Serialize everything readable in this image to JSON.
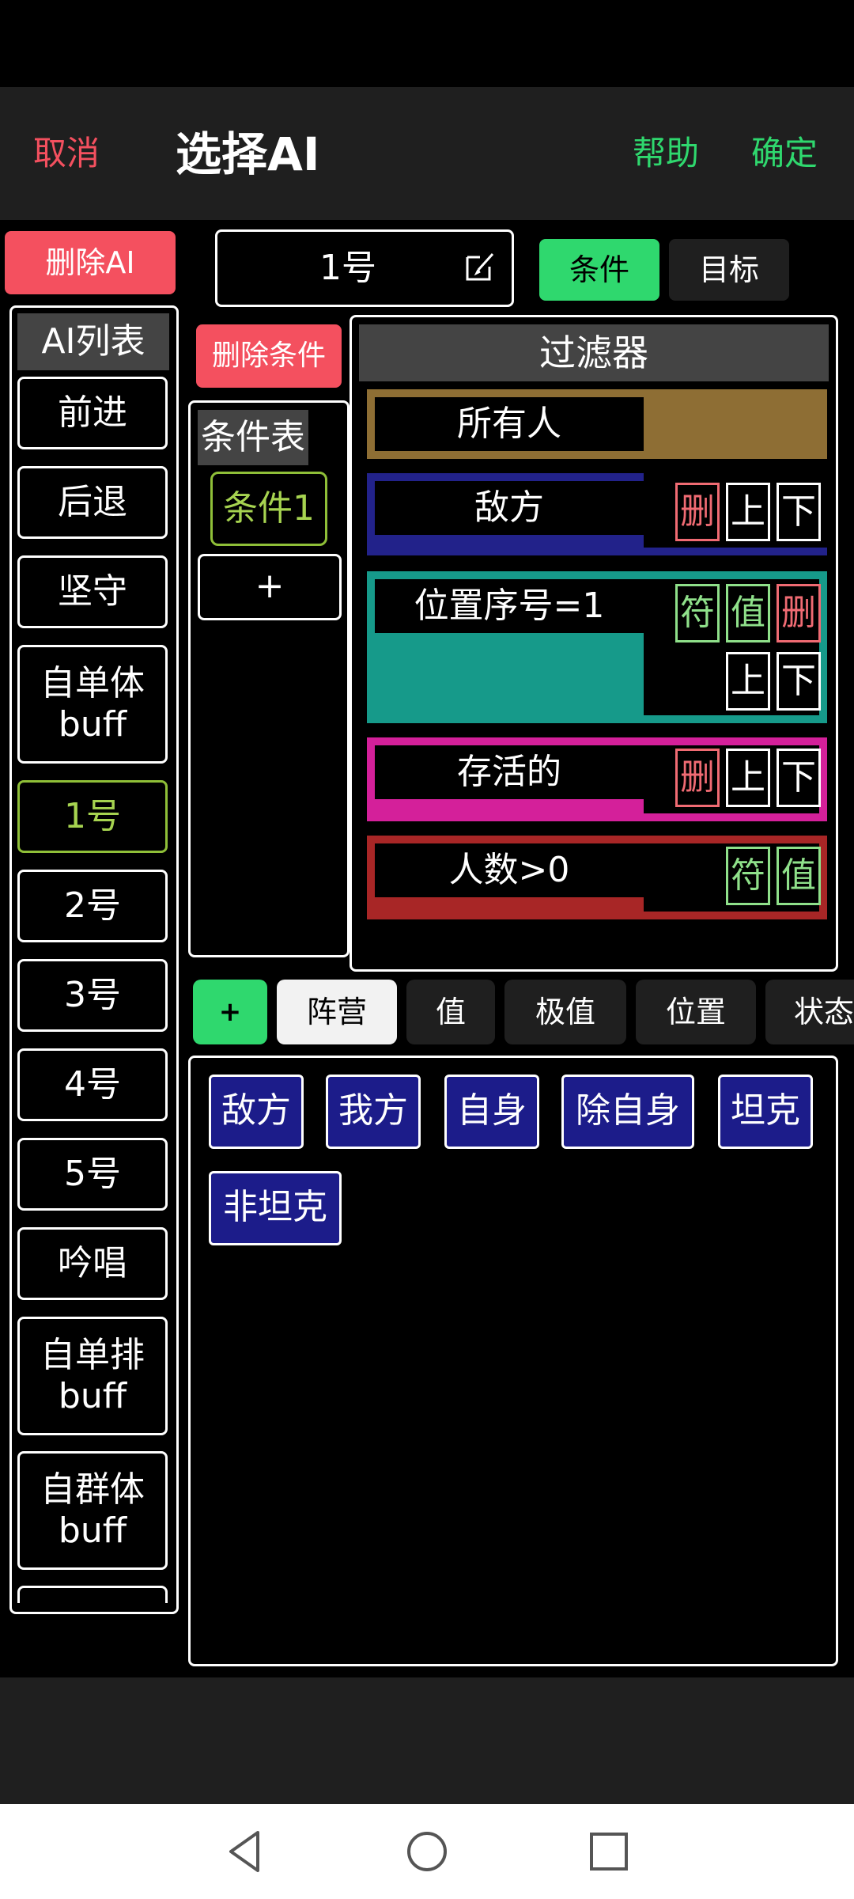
{
  "header": {
    "cancel": "取消",
    "title": "选择AI",
    "help": "帮助",
    "confirm": "确定"
  },
  "ai_panel": {
    "delete_button": "删除AI",
    "list_title": "AI列表",
    "items": [
      {
        "line1": "前进",
        "line2": ""
      },
      {
        "line1": "后退",
        "line2": ""
      },
      {
        "line1": "坚守",
        "line2": ""
      },
      {
        "line1": "自单体",
        "line2": "buff"
      },
      {
        "line1": "1号",
        "line2": ""
      },
      {
        "line1": "2号",
        "line2": ""
      },
      {
        "line1": "3号",
        "line2": ""
      },
      {
        "line1": "4号",
        "line2": ""
      },
      {
        "line1": "5号",
        "line2": ""
      },
      {
        "line1": "吟唱",
        "line2": ""
      },
      {
        "line1": "自单排",
        "line2": "buff"
      },
      {
        "line1": "自群体",
        "line2": "buff"
      }
    ],
    "selected": "1号"
  },
  "name_field": {
    "value": "1号"
  },
  "mode_tabs": {
    "condition": "条件",
    "target": "目标"
  },
  "condition_panel": {
    "delete_button": "删除条件",
    "table_title": "条件表",
    "items": [
      "条件1"
    ],
    "add_symbol": "+"
  },
  "filter_panel": {
    "title": "过滤器",
    "filters": [
      {
        "label": "所有人",
        "color": "#8e6e34"
      },
      {
        "label": "敌方",
        "color": "#22228a"
      },
      {
        "label": "位置序号=1",
        "color": "#169a8a"
      },
      {
        "label": "存活的",
        "color": "#d4209a"
      },
      {
        "label": "人数>0",
        "color": "#a82626"
      }
    ],
    "btn_delete": "删",
    "btn_up": "上",
    "btn_down": "下",
    "btn_symbol": "符",
    "btn_value": "值"
  },
  "category_tabs": {
    "add": "+",
    "items": [
      "阵营",
      "值",
      "极值",
      "位置",
      "状态"
    ]
  },
  "options": {
    "items": [
      "敌方",
      "我方",
      "自身",
      "除自身",
      "坦克",
      "非坦克"
    ]
  },
  "colors": {
    "accent_green": "#2fd86e",
    "delete_red": "#f4505f",
    "selected_green": "#a6d350"
  }
}
